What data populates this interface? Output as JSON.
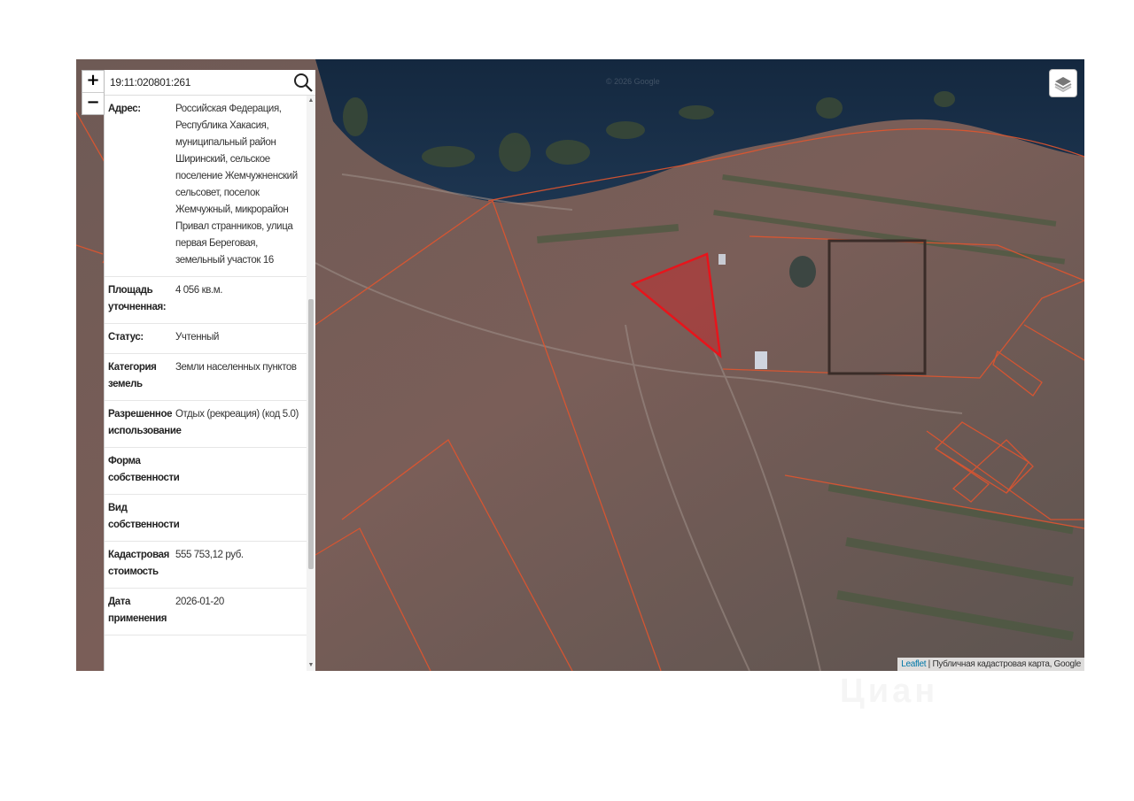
{
  "map": {
    "zoom_in_label": "+",
    "zoom_out_label": "−",
    "copyright_watermark": "© 2026 Google",
    "attribution": {
      "leaflet_link": "Leaflet",
      "separator": " | ",
      "sources": "Публичная кадастровая карта, Google"
    },
    "layers_icon": "layers-icon",
    "parcel_highlight_color": "#e8141b",
    "parcel_outline_color": "#e85a3a"
  },
  "search": {
    "value": "19:11:020801:261",
    "icon": "search-icon"
  },
  "parcel_info": {
    "rows": [
      {
        "key": "Адрес:",
        "value": "Российская Федерация, Республика Хакасия, муниципальный район Ширинский, сельское поселение Жемчужненский сельсовет, поселок Жемчужный, микрорайон Привал странников, улица первая Береговая, земельный участок 16"
      },
      {
        "key": "Площадь уточненная:",
        "value": "4 056 кв.м."
      },
      {
        "key": "Статус:",
        "value": "Учтенный"
      },
      {
        "key": "Категория земель",
        "value": "Земли населенных пунктов"
      },
      {
        "key": "Разрешенное использование",
        "value": "Отдых (рекреация) (код 5.0)"
      },
      {
        "key": "Форма собственности",
        "value": ""
      },
      {
        "key": "Вид собственности",
        "value": ""
      },
      {
        "key": "Кадастровая стоимость",
        "value": "555 753,12 руб."
      },
      {
        "key": "Дата применения",
        "value": "2026-01-20"
      }
    ]
  },
  "watermark_logo": "Циан"
}
